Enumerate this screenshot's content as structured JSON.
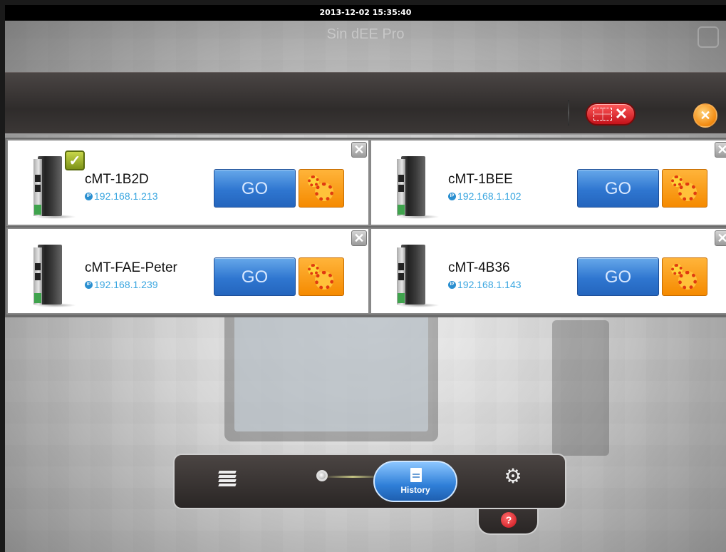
{
  "status_bar": {
    "datetime": "2013-12-02 15:35:40"
  },
  "background": {
    "title": "Sin dEE Pro"
  },
  "header": {
    "delete_all_icon": "delete-all-icon",
    "close_icon": "close-icon"
  },
  "devices": [
    {
      "name": "cMT-1B2D",
      "ip": "192.168.1.213",
      "selected": true,
      "go_label": "GO"
    },
    {
      "name": "cMT-1BEE",
      "ip": "192.168.1.102",
      "selected": false,
      "go_label": "GO"
    },
    {
      "name": "cMT-FAE-Peter",
      "ip": "192.168.1.239",
      "selected": false,
      "go_label": "GO"
    },
    {
      "name": "cMT-4B36",
      "ip": "192.168.1.143",
      "selected": false,
      "go_label": "GO"
    }
  ],
  "ip_badge": "IP",
  "check_mark": "✓",
  "close_glyph": "✕",
  "toolbar": {
    "items": [
      {
        "icon": "stack-icon"
      },
      {
        "icon": "search-icon"
      },
      {
        "icon": "history-icon",
        "label": "History",
        "active": true
      },
      {
        "icon": "gear-icon"
      }
    ],
    "help_label": "?"
  },
  "colors": {
    "go_button": "#2f76d0",
    "settings_button": "#f58a00",
    "ip_text": "#3aa6e0",
    "delete_all": "#c4121a"
  }
}
